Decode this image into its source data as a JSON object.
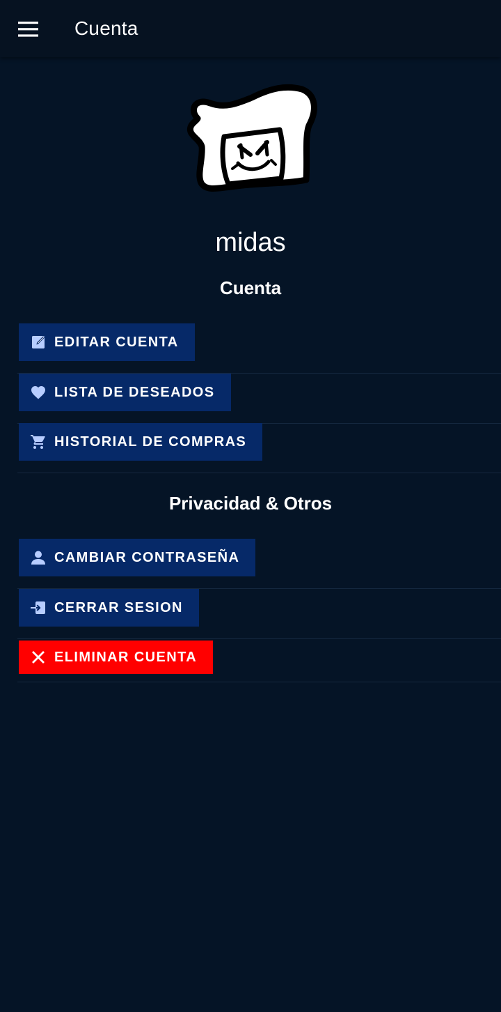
{
  "appbar": {
    "title": "Cuenta",
    "menu_icon": "hamburger-menu-icon"
  },
  "profile": {
    "username": "midas",
    "avatar": "cartoon-bread-character-avatar"
  },
  "sections": {
    "account_title": "Cuenta",
    "privacy_title": "Privacidad & Otros"
  },
  "buttons": {
    "edit_account": {
      "label": "EDITAR CUENTA",
      "icon": "edit-icon"
    },
    "wishlist": {
      "label": "LISTA DE DESEADOS",
      "icon": "heart-icon"
    },
    "purchase_history": {
      "label": "HISTORIAL DE COMPRAS",
      "icon": "cart-icon"
    },
    "change_password": {
      "label": "CAMBIAR CONTRASEÑA",
      "icon": "person-icon"
    },
    "logout": {
      "label": "CERRAR SESION",
      "icon": "login-icon"
    },
    "delete_account": {
      "label": "ELIMINAR CUENTA",
      "icon": "close-icon"
    }
  },
  "colors": {
    "background": "#051426",
    "button": "#062968",
    "danger": "#ff0000",
    "icon_tint": "#b7cdff"
  }
}
